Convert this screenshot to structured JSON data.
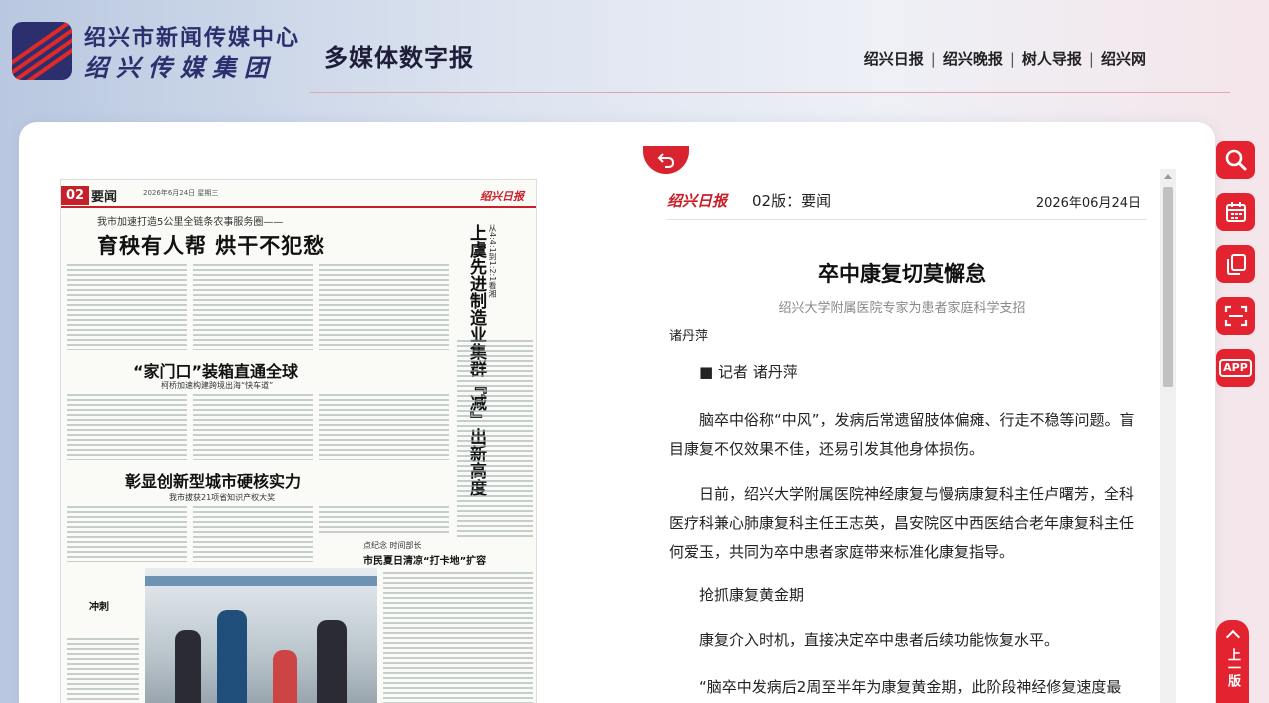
{
  "header": {
    "logo_line1": "绍兴市新闻传媒中心",
    "logo_line2": "绍兴传媒集团",
    "title": "多媒体数字报",
    "nav": [
      "绍兴日报",
      "绍兴晚报",
      "树人导报",
      "绍兴网"
    ],
    "nav_sep": "|"
  },
  "paper": {
    "page_no": "02",
    "section": "要闻",
    "date_line": "2026年6月24日 星期三",
    "brand": "绍兴日报",
    "kicker": "我市加速打造5公里全链条农事服务圈——",
    "headline1": "育秧有人帮 烘干不犯愁",
    "headline2": "“家门口”装箱直通全球",
    "sub2": "柯桥加速构建跨境出海“快车道”",
    "headline3": "彰显创新型城市硬核实力",
    "sub3": "我市拔获21项省知识产权大奖",
    "vertical_small": "从4:4:1到1:2:1看湘",
    "vertical_headline": "上虞先进制造业集群『减』出新高度",
    "caption_small": "点纪念   时间部长",
    "caption_big": "市民夏日清凉“打卡地”扩容",
    "chongci": "冲刺"
  },
  "article": {
    "brand": "绍兴日报",
    "page_label": "02版：要闻",
    "date": "2026年06月24日",
    "title": "卒中康复切莫懈怠",
    "subtitle": "绍兴大学附属医院专家为患者家庭科学支招",
    "author": "诸丹萍",
    "paragraphs": [
      "■ 记者 诸丹萍",
      "脑卒中俗称“中风”，发病后常遗留肢体偏瘫、行走不稳等问题。盲目康复不仅效果不佳，还易引发其他身体损伤。",
      "日前，绍兴大学附属医院神经康复与慢病康复科主任卢曙芳，全科医疗科兼心肺康复科主任王志英，昌安院区中西医结合老年康复科主任何爱玉，共同为卒中患者家庭带来标准化康复指导。",
      "抢抓康复黄金期",
      "康复介入时机，直接决定卒中患者后续功能恢复水平。",
      "“脑卒中发病后2周至半年为康复黄金期，此阶段神经修复速度最"
    ]
  },
  "tools": {
    "items": [
      "search-icon",
      "calendar-icon",
      "copy-icon",
      "scan-icon",
      "app-icon"
    ],
    "app_label": "APP",
    "prev_label": "上一版"
  },
  "colors": {
    "accent": "#e3232f",
    "brand_blue": "#2c2f6e"
  }
}
